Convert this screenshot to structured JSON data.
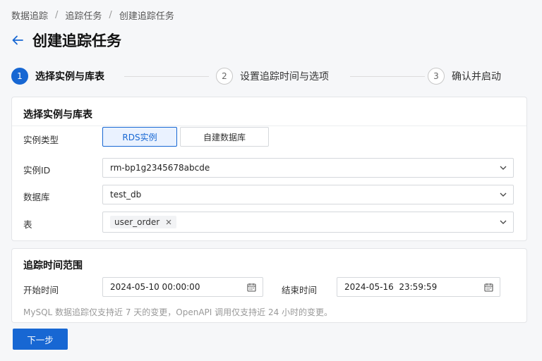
{
  "breadcrumb": [
    "数据追踪",
    "追踪任务",
    "创建追踪任务"
  ],
  "breadcrumb_sep": "/",
  "page_title": "创建追踪任务",
  "steps": [
    {
      "num": "1",
      "label": "选择实例与库表",
      "active": true
    },
    {
      "num": "2",
      "label": "设置追踪时间与选项",
      "active": false
    },
    {
      "num": "3",
      "label": "确认并启动",
      "active": false
    }
  ],
  "section_instance": {
    "title": "选择实例与库表",
    "instance_type_label": "实例类型",
    "instance_type_options": [
      "RDS实例",
      "自建数据库"
    ],
    "instance_type_selected": "RDS实例",
    "instance_id_label": "实例ID",
    "instance_id_value": "rm-bp1g2345678abcde",
    "database_label": "数据库",
    "database_value": "test_db",
    "table_label": "表",
    "table_tags": [
      "user_order"
    ]
  },
  "section_time": {
    "title": "追踪时间范围",
    "start_label": "开始时间",
    "start_value": "2024-05-10 00:00:00",
    "end_label": "结束时间",
    "end_value": "2024-05-16  23:59:59",
    "hint": "MySQL 数据追踪仅支持近 7 天的变更，OpenAPI 调用仅支持近 24 小时的变更。"
  },
  "next_button": "下一步",
  "colors": {
    "accent": "#1767d3",
    "background": "#f6f7f9",
    "card": "#ffffff"
  }
}
